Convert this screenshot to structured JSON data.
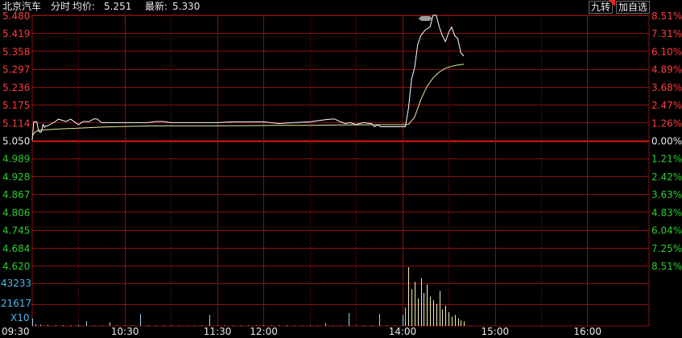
{
  "header": {
    "stock_name": "北京汽车",
    "view_label": "分时",
    "avg_label": "均价:",
    "avg_value": "5.251",
    "last_label": "最新:",
    "last_value": "5.330",
    "btn_jiuzhuan": "九转",
    "btn_add_watch": "加自选"
  },
  "colors": {
    "background": "#000000",
    "grid": "#8b1010",
    "zero_line": "#d81818",
    "price_line": "#ffffff",
    "avg_line": "#e8e8a0",
    "up": "#ff3c3c",
    "down": "#2ecc2e",
    "neutral": "#e8e8e8",
    "volume_axis": "#4fb8e8",
    "volume_bar_up": "#f0f0b0",
    "volume_bar_neutral": "#9ad8f0"
  },
  "chart_data": {
    "type": "line",
    "prev_close": 5.05,
    "price_ylim": [
      4.62,
      5.48
    ],
    "left_axis_ticks": [
      "5.480",
      "5.419",
      "5.358",
      "5.297",
      "5.236",
      "5.175",
      "5.114",
      "5.050",
      "4.989",
      "4.928",
      "4.867",
      "4.806",
      "4.745",
      "4.684",
      "4.620"
    ],
    "right_axis_ticks": [
      "8.51%",
      "7.31%",
      "6.10%",
      "4.89%",
      "3.68%",
      "2.47%",
      "1.26%",
      "0.00%",
      "1.21%",
      "2.42%",
      "3.63%",
      "4.83%",
      "6.04%",
      "7.25%",
      "8.51%"
    ],
    "volume_axis_ticks": [
      "43233",
      "21617",
      "X10"
    ],
    "time_ticks": [
      "09:30",
      "10:30",
      "11:30",
      "12:00",
      "14:00",
      "15:00",
      "16:00"
    ],
    "x_range_minutes": [
      0,
      400
    ],
    "volume_max": 64000,
    "series": [
      {
        "name": "",
        "role": "price",
        "x": [
          0,
          1,
          2,
          3,
          4,
          5,
          6,
          7,
          8,
          9,
          10,
          15,
          17,
          22,
          25,
          30,
          33,
          37,
          40,
          42,
          45,
          50,
          55,
          57,
          60,
          62,
          65,
          70,
          75,
          80,
          85,
          90,
          95,
          100,
          110,
          120,
          130,
          140,
          150,
          160,
          170,
          180,
          190,
          196,
          200,
          203,
          206,
          210,
          215,
          220,
          222,
          224,
          226,
          230,
          235,
          240,
          242,
          244,
          246,
          248,
          250,
          252,
          255,
          258,
          260,
          262,
          264,
          266,
          268,
          270,
          272,
          274,
          276,
          278,
          280
        ],
        "y": [
          5.05,
          5.114,
          5.114,
          5.114,
          5.085,
          5.078,
          5.08,
          5.105,
          5.095,
          5.1,
          5.1,
          5.115,
          5.123,
          5.115,
          5.123,
          5.104,
          5.115,
          5.115,
          5.124,
          5.124,
          5.111,
          5.111,
          5.111,
          5.111,
          5.111,
          5.111,
          5.111,
          5.111,
          5.111,
          5.115,
          5.115,
          5.111,
          5.111,
          5.111,
          5.111,
          5.111,
          5.114,
          5.114,
          5.114,
          5.108,
          5.111,
          5.114,
          5.121,
          5.124,
          5.114,
          5.108,
          5.111,
          5.105,
          5.111,
          5.108,
          5.097,
          5.104,
          5.097,
          5.097,
          5.097,
          5.097,
          5.097,
          5.16,
          5.26,
          5.3,
          5.38,
          5.41,
          5.43,
          5.44,
          5.48,
          5.48,
          5.44,
          5.41,
          5.39,
          5.42,
          5.44,
          5.41,
          5.4,
          5.35,
          5.34
        ]
      },
      {
        "name": "",
        "role": "average",
        "x": [
          0,
          2,
          5,
          10,
          20,
          30,
          45,
          60,
          80,
          100,
          120,
          140,
          160,
          180,
          200,
          220,
          230,
          240,
          244,
          248,
          252,
          256,
          260,
          264,
          268,
          272,
          276,
          280
        ],
        "y": [
          5.065,
          5.08,
          5.085,
          5.087,
          5.09,
          5.092,
          5.096,
          5.098,
          5.1,
          5.1,
          5.1,
          5.101,
          5.102,
          5.102,
          5.103,
          5.104,
          5.104,
          5.104,
          5.105,
          5.13,
          5.19,
          5.235,
          5.265,
          5.285,
          5.298,
          5.305,
          5.309,
          5.312
        ]
      }
    ],
    "volume": {
      "x": [
        0,
        2,
        5,
        10,
        15,
        20,
        25,
        30,
        35,
        40,
        45,
        50,
        55,
        60,
        65,
        70,
        75,
        80,
        85,
        90,
        95,
        100,
        105,
        110,
        115,
        120,
        125,
        130,
        135,
        140,
        145,
        150,
        155,
        160,
        165,
        170,
        175,
        180,
        185,
        190,
        195,
        200,
        205,
        210,
        215,
        220,
        225,
        230,
        235,
        240,
        242,
        244,
        246,
        248,
        250,
        252,
        254,
        256,
        258,
        260,
        262,
        264,
        266,
        268,
        270,
        272,
        274,
        276,
        278,
        280
      ],
      "values": [
        8000,
        2000,
        1500,
        1200,
        800,
        900,
        700,
        1200,
        5000,
        600,
        500,
        4000,
        600,
        500,
        700,
        13000,
        800,
        600,
        500,
        700,
        500,
        400,
        600,
        500,
        12000,
        400,
        600,
        500,
        700,
        500,
        600,
        800,
        500,
        700,
        900,
        500,
        600,
        700,
        500,
        3000,
        500,
        600,
        14000,
        500,
        700,
        600,
        13000,
        500,
        600,
        12000,
        20000,
        64000,
        40000,
        48000,
        30000,
        52000,
        36000,
        45000,
        32000,
        28000,
        24000,
        38000,
        18000,
        22000,
        15000,
        10000,
        12000,
        8000,
        6000,
        5000
      ]
    }
  }
}
